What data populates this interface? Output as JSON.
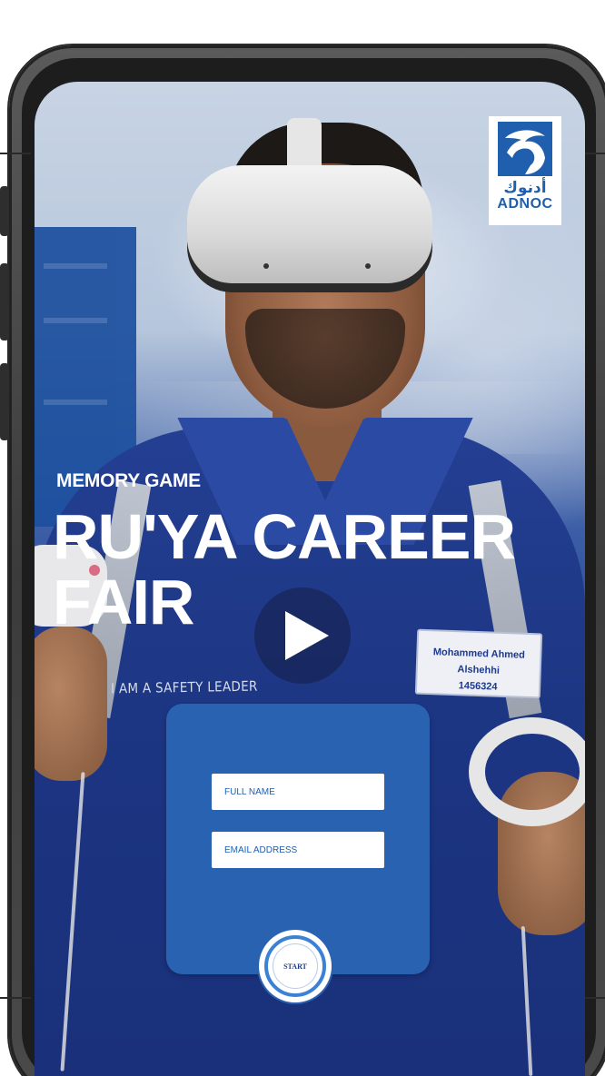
{
  "logo": {
    "arabic_text": "أدنوك",
    "english_text": "ADNOC",
    "icon": "adnoc-falcon-icon",
    "color": "#1f5fad"
  },
  "hero": {
    "subtitle": "MEMORY GAME",
    "title": "RU'YA CAREER FAIR"
  },
  "photo": {
    "name_tag_line1": "Mohammed Ahmed Alshehhi",
    "name_tag_line2": "1456324",
    "shirt_text": "I AM A SAFETY LEADER"
  },
  "video": {
    "play_icon": "play-icon"
  },
  "form": {
    "full_name_placeholder": "FULL NAME",
    "full_name_value": "",
    "email_placeholder": "EMAIL ADDRESS",
    "email_value": "",
    "start_label": "START",
    "card_color": "#2a62b2"
  }
}
